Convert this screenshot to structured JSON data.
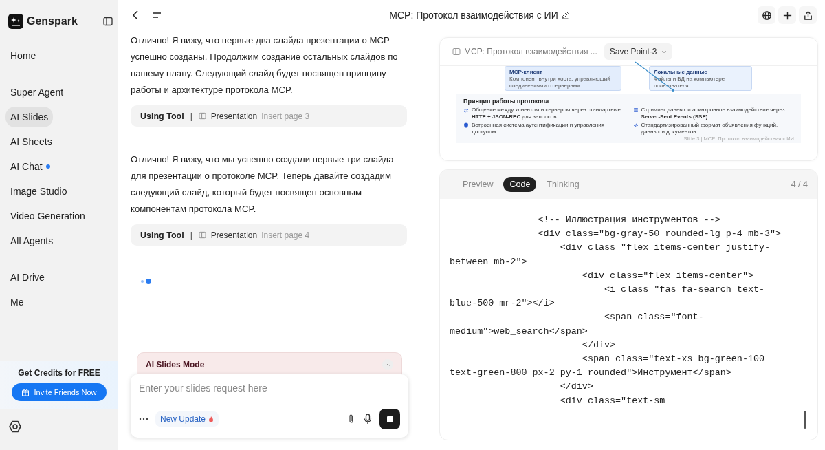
{
  "sidebar": {
    "brand": "Genspark",
    "groups": [
      {
        "items": [
          {
            "label": "Home",
            "selected": false,
            "dot": false
          }
        ]
      },
      {
        "items": [
          {
            "label": "Super Agent",
            "selected": false,
            "dot": false
          },
          {
            "label": "AI Slides",
            "selected": true,
            "dot": false
          },
          {
            "label": "AI Sheets",
            "selected": false,
            "dot": false
          },
          {
            "label": "AI Chat",
            "selected": false,
            "dot": true
          },
          {
            "label": "Image Studio",
            "selected": false,
            "dot": false
          },
          {
            "label": "Video Generation",
            "selected": false,
            "dot": false
          },
          {
            "label": "All Agents",
            "selected": false,
            "dot": false
          }
        ]
      },
      {
        "items": [
          {
            "label": "AI Drive",
            "selected": false,
            "dot": false
          },
          {
            "label": "Me",
            "selected": false,
            "dot": false
          }
        ]
      }
    ],
    "promo": {
      "title": "Get Credits for FREE",
      "button": "Invite Friends Now"
    }
  },
  "header": {
    "title": "MCP: Протокол взаимодействия с ИИ"
  },
  "chat": {
    "messages": [
      {
        "kind": "text",
        "text": "Отлично! Я вижу, что первые два слайда презентации о MCP успешно созданы. Продолжим создание остальных слайдов по нашему плану. Следующий слайд будет посвящен принципу работы и архитектуре протокола MCP."
      },
      {
        "kind": "tool",
        "label": "Using Tool",
        "separator": "|",
        "tool": "Presentation",
        "detail": "Insert page 3"
      },
      {
        "kind": "text",
        "text": "Отлично! Я вижу, что мы успешно создали первые три слайда для презентации о протоколе MCP. Теперь давайте создадим следующий слайд, который будет посвящен основным компонентам протокола MCP."
      },
      {
        "kind": "tool",
        "label": "Using Tool",
        "separator": "|",
        "tool": "Presentation",
        "detail": "Insert page 4"
      }
    ],
    "loading": true
  },
  "composer": {
    "mode": "AI Slides Mode",
    "placeholder": "Enter your slides request here",
    "badge": "New Update"
  },
  "preview": {
    "title": "MCP: Протокол взаимодействия ...",
    "save_point": "Save Point-3",
    "slide": {
      "cards": [
        {
          "title": "MCP-клиент",
          "text": "Компонент внутри хоста, управляющий соединениями с серверами"
        },
        {
          "title": "Локальные данные",
          "text": "Файлы и БД на компьютере пользователя"
        }
      ],
      "section_title": "Принцип работы протокола",
      "points": [
        "Общение между клиентом и сервером через стандартные **HTTP + JSON-RPC** для запросов",
        "Стриминг данных и асинхронное взаимодействие через **Server-Sent Events (SSE)**",
        "Встроенная система аутентификации и управления доступом",
        "Стандартизированный формат объявления функций, данных и документов"
      ],
      "footer": "Slide 3 | MCP: Протокол взаимодействия с ИИ"
    }
  },
  "code_panel": {
    "tabs": [
      {
        "label": "Preview",
        "selected": false
      },
      {
        "label": "Code",
        "selected": true
      },
      {
        "label": "Thinking",
        "selected": false
      }
    ],
    "page": "4 / 4",
    "lines": [
      "                <!-- Иллюстрация инструментов -->",
      "                <div class=\"bg-gray-50 rounded-lg p-4 mb-3\">",
      "                    <div class=\"flex items-center justify-",
      "between mb-2\">",
      "                        <div class=\"flex items-center\">",
      "                            <i class=\"fas fa-search text-",
      "blue-500 mr-2\"></i>",
      "                            <span class=\"font-",
      "medium\">web_search</span>",
      "                        </div>",
      "                        <span class=\"text-xs bg-green-100",
      "text-green-800 px-2 py-1 rounded\">Инструмент</span>",
      "                    </div>",
      "                    <div class=\"text-sm"
    ]
  }
}
